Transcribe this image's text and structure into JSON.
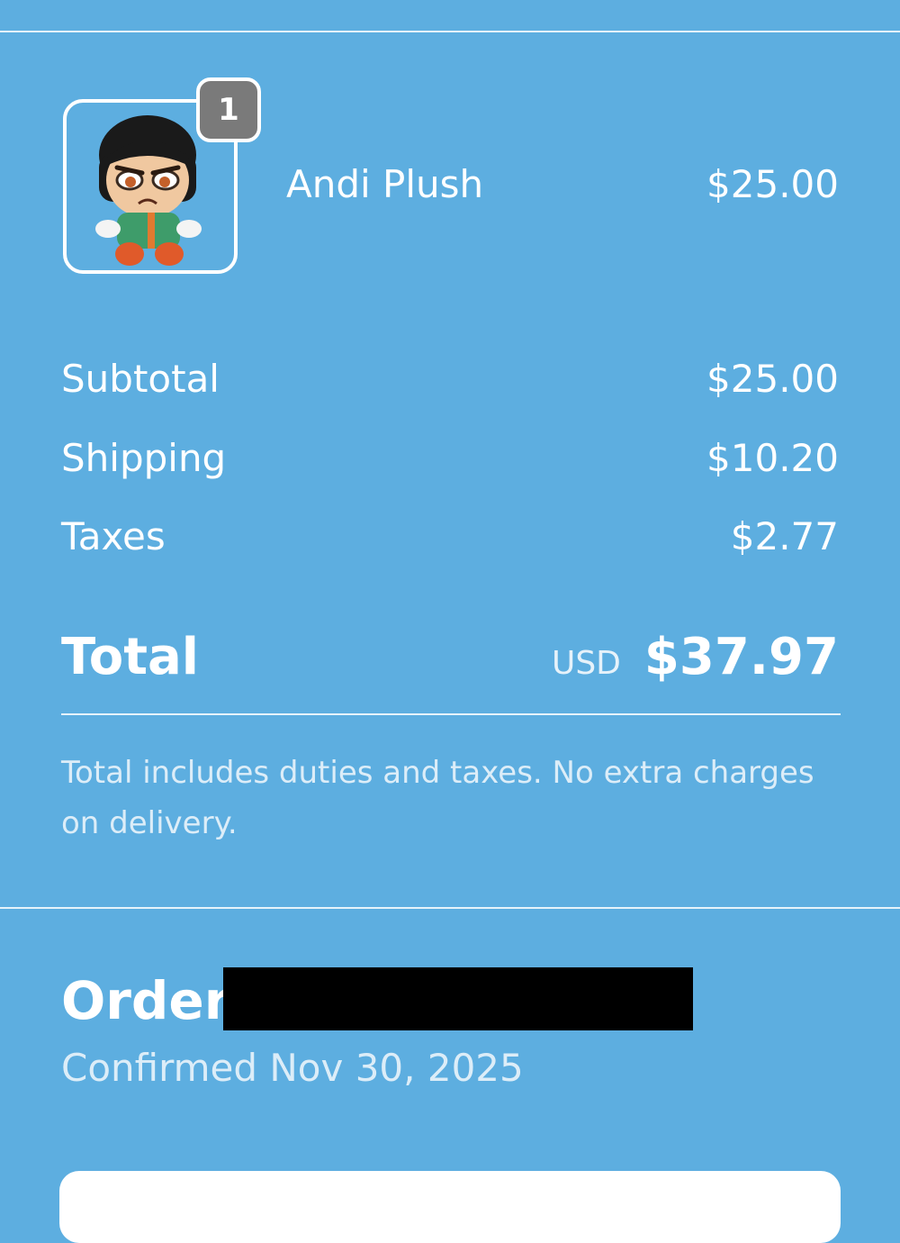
{
  "line_item": {
    "quantity": "1",
    "name": "Andi Plush",
    "price": "$25.00",
    "thumbnail_icon": "plush-doll-image"
  },
  "summary": {
    "subtotal_label": "Subtotal",
    "subtotal_value": "$25.00",
    "shipping_label": "Shipping",
    "shipping_value": "$10.20",
    "taxes_label": "Taxes",
    "taxes_value": "$2.77"
  },
  "total": {
    "label": "Total",
    "currency": "USD",
    "value": "$37.97",
    "note": "Total includes duties and taxes. No extra charges on delivery."
  },
  "order": {
    "label": "Order",
    "confirmed_text": "Confirmed Nov 30, 2025"
  },
  "colors": {
    "background": "#5daee0",
    "text": "#ffffff",
    "badge": "#7a7a7a",
    "redaction": "#000000"
  }
}
